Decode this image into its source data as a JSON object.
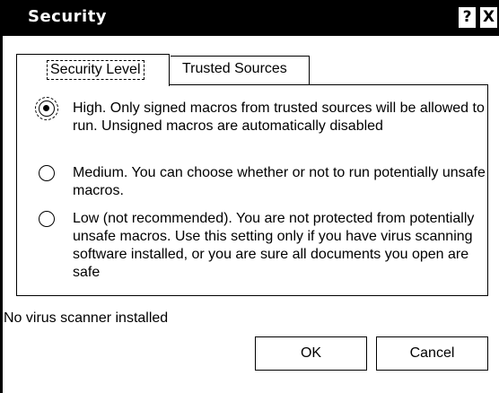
{
  "window": {
    "title": "Security",
    "help_glyph": "?",
    "close_glyph": "X"
  },
  "tabs": [
    {
      "label": "Security Level",
      "selected": true
    },
    {
      "label": "Trusted Sources",
      "selected": false
    }
  ],
  "options": [
    {
      "text": "High. Only signed macros from trusted sources will be allowed to run. Unsigned macros are automatically disabled",
      "selected": true
    },
    {
      "text": "Medium. You can choose whether or not to run potentially unsafe macros.",
      "selected": false
    },
    {
      "text": "Low (not recommended). You are not protected from potentially unsafe macros. Use this setting only if you have virus scanning software installed, or you are sure all documents you open are safe",
      "selected": false
    }
  ],
  "status": "No virus scanner installed",
  "buttons": {
    "ok": "OK",
    "cancel": "Cancel"
  }
}
